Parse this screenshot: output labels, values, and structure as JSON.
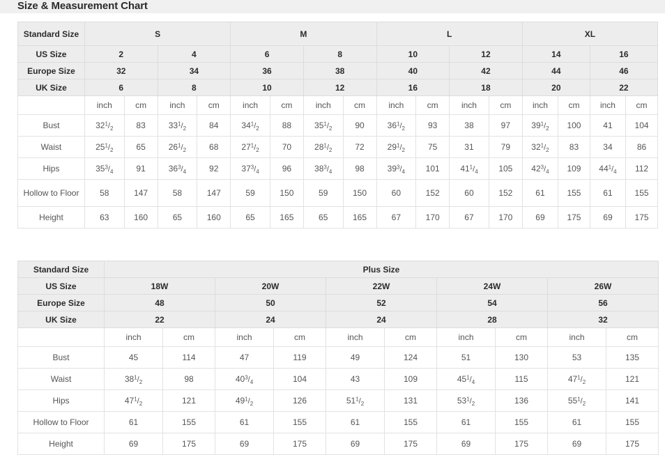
{
  "page": {
    "title": "Size & Measurement Chart",
    "title_bar_bg": "#f0f0f0",
    "header_cell_bg": "#ededed",
    "border_color": "#e2e2e2",
    "text_color": "#555555"
  },
  "standard_table": {
    "labels": {
      "standard_size": "Standard Size",
      "us_size": "US Size",
      "europe_size": "Europe Size",
      "uk_size": "UK Size",
      "blank": ""
    },
    "groups": [
      {
        "name": "S",
        "span": 4
      },
      {
        "name": "M",
        "span": 4
      },
      {
        "name": "L",
        "span": 4
      },
      {
        "name": "XL",
        "span": 4
      }
    ],
    "us_sizes": [
      "2",
      "4",
      "6",
      "8",
      "10",
      "12",
      "14",
      "16"
    ],
    "europe_sizes": [
      "32",
      "34",
      "36",
      "38",
      "40",
      "42",
      "44",
      "46"
    ],
    "uk_sizes": [
      "6",
      "8",
      "10",
      "12",
      "16",
      "18",
      "20",
      "22"
    ],
    "units": [
      "inch",
      "cm",
      "inch",
      "cm",
      "inch",
      "cm",
      "inch",
      "cm",
      "inch",
      "cm",
      "inch",
      "cm",
      "inch",
      "cm",
      "inch",
      "cm"
    ],
    "rows": [
      {
        "label": "Bust",
        "tall": false,
        "values": [
          {
            "whole": "32",
            "num": "1",
            "den": "2"
          },
          {
            "whole": "83"
          },
          {
            "whole": "33",
            "num": "1",
            "den": "2"
          },
          {
            "whole": "84"
          },
          {
            "whole": "34",
            "num": "1",
            "den": "2"
          },
          {
            "whole": "88"
          },
          {
            "whole": "35",
            "num": "1",
            "den": "2"
          },
          {
            "whole": "90"
          },
          {
            "whole": "36",
            "num": "1",
            "den": "2"
          },
          {
            "whole": "93"
          },
          {
            "whole": "38"
          },
          {
            "whole": "97"
          },
          {
            "whole": "39",
            "num": "1",
            "den": "2"
          },
          {
            "whole": "100"
          },
          {
            "whole": "41"
          },
          {
            "whole": "104"
          }
        ]
      },
      {
        "label": "Waist",
        "tall": false,
        "values": [
          {
            "whole": "25",
            "num": "1",
            "den": "2"
          },
          {
            "whole": "65"
          },
          {
            "whole": "26",
            "num": "1",
            "den": "2"
          },
          {
            "whole": "68"
          },
          {
            "whole": "27",
            "num": "1",
            "den": "2"
          },
          {
            "whole": "70"
          },
          {
            "whole": "28",
            "num": "1",
            "den": "2"
          },
          {
            "whole": "72"
          },
          {
            "whole": "29",
            "num": "1",
            "den": "2"
          },
          {
            "whole": "75"
          },
          {
            "whole": "31"
          },
          {
            "whole": "79"
          },
          {
            "whole": "32",
            "num": "1",
            "den": "2"
          },
          {
            "whole": "83"
          },
          {
            "whole": "34"
          },
          {
            "whole": "86"
          }
        ]
      },
      {
        "label": "Hips",
        "tall": false,
        "values": [
          {
            "whole": "35",
            "num": "3",
            "den": "4"
          },
          {
            "whole": "91"
          },
          {
            "whole": "36",
            "num": "3",
            "den": "4"
          },
          {
            "whole": "92"
          },
          {
            "whole": "37",
            "num": "3",
            "den": "4"
          },
          {
            "whole": "96"
          },
          {
            "whole": "38",
            "num": "3",
            "den": "4"
          },
          {
            "whole": "98"
          },
          {
            "whole": "39",
            "num": "3",
            "den": "4"
          },
          {
            "whole": "101"
          },
          {
            "whole": "41",
            "num": "1",
            "den": "4"
          },
          {
            "whole": "105"
          },
          {
            "whole": "42",
            "num": "3",
            "den": "4"
          },
          {
            "whole": "109"
          },
          {
            "whole": "44",
            "num": "1",
            "den": "4"
          },
          {
            "whole": "112"
          }
        ]
      },
      {
        "label": "Hollow to Floor",
        "tall": true,
        "values": [
          {
            "whole": "58"
          },
          {
            "whole": "147"
          },
          {
            "whole": "58"
          },
          {
            "whole": "147"
          },
          {
            "whole": "59"
          },
          {
            "whole": "150"
          },
          {
            "whole": "59"
          },
          {
            "whole": "150"
          },
          {
            "whole": "60"
          },
          {
            "whole": "152"
          },
          {
            "whole": "60"
          },
          {
            "whole": "152"
          },
          {
            "whole": "61"
          },
          {
            "whole": "155"
          },
          {
            "whole": "61"
          },
          {
            "whole": "155"
          }
        ]
      },
      {
        "label": "Height",
        "tall": false,
        "values": [
          {
            "whole": "63"
          },
          {
            "whole": "160"
          },
          {
            "whole": "65"
          },
          {
            "whole": "160"
          },
          {
            "whole": "65"
          },
          {
            "whole": "165"
          },
          {
            "whole": "65"
          },
          {
            "whole": "165"
          },
          {
            "whole": "67"
          },
          {
            "whole": "170"
          },
          {
            "whole": "67"
          },
          {
            "whole": "170"
          },
          {
            "whole": "69"
          },
          {
            "whole": "175"
          },
          {
            "whole": "69"
          },
          {
            "whole": "175"
          }
        ]
      }
    ]
  },
  "plus_table": {
    "labels": {
      "standard_size": "Standard Size",
      "us_size": "US Size",
      "europe_size": "Europe Size",
      "uk_size": "UK Size",
      "blank": ""
    },
    "group_title": "Plus Size",
    "us_sizes": [
      "18W",
      "20W",
      "22W",
      "24W",
      "26W"
    ],
    "europe_sizes": [
      "48",
      "50",
      "52",
      "54",
      "56"
    ],
    "uk_sizes": [
      "22",
      "24",
      "24",
      "28",
      "32"
    ],
    "units": [
      "inch",
      "cm",
      "inch",
      "cm",
      "inch",
      "cm",
      "inch",
      "cm",
      "inch",
      "cm"
    ],
    "rows": [
      {
        "label": "Bust",
        "values": [
          {
            "whole": "45"
          },
          {
            "whole": "114"
          },
          {
            "whole": "47"
          },
          {
            "whole": "119"
          },
          {
            "whole": "49"
          },
          {
            "whole": "124"
          },
          {
            "whole": "51"
          },
          {
            "whole": "130"
          },
          {
            "whole": "53"
          },
          {
            "whole": "135"
          }
        ]
      },
      {
        "label": "Waist",
        "values": [
          {
            "whole": "38",
            "num": "1",
            "den": "2"
          },
          {
            "whole": "98"
          },
          {
            "whole": "40",
            "num": "3",
            "den": "4"
          },
          {
            "whole": "104"
          },
          {
            "whole": "43"
          },
          {
            "whole": "109"
          },
          {
            "whole": "45",
            "num": "1",
            "den": "4"
          },
          {
            "whole": "115"
          },
          {
            "whole": "47",
            "num": "1",
            "den": "2"
          },
          {
            "whole": "121"
          }
        ]
      },
      {
        "label": "Hips",
        "values": [
          {
            "whole": "47",
            "num": "1",
            "den": "2"
          },
          {
            "whole": "121"
          },
          {
            "whole": "49",
            "num": "1",
            "den": "2"
          },
          {
            "whole": "126"
          },
          {
            "whole": "51",
            "num": "1",
            "den": "2"
          },
          {
            "whole": "131"
          },
          {
            "whole": "53",
            "num": "1",
            "den": "2"
          },
          {
            "whole": "136"
          },
          {
            "whole": "55",
            "num": "1",
            "den": "2"
          },
          {
            "whole": "141"
          }
        ]
      },
      {
        "label": "Hollow to Floor",
        "values": [
          {
            "whole": "61"
          },
          {
            "whole": "155"
          },
          {
            "whole": "61"
          },
          {
            "whole": "155"
          },
          {
            "whole": "61"
          },
          {
            "whole": "155"
          },
          {
            "whole": "61"
          },
          {
            "whole": "155"
          },
          {
            "whole": "61"
          },
          {
            "whole": "155"
          }
        ]
      },
      {
        "label": "Height",
        "values": [
          {
            "whole": "69"
          },
          {
            "whole": "175"
          },
          {
            "whole": "69"
          },
          {
            "whole": "175"
          },
          {
            "whole": "69"
          },
          {
            "whole": "175"
          },
          {
            "whole": "69"
          },
          {
            "whole": "175"
          },
          {
            "whole": "69"
          },
          {
            "whole": "175"
          }
        ]
      }
    ]
  }
}
